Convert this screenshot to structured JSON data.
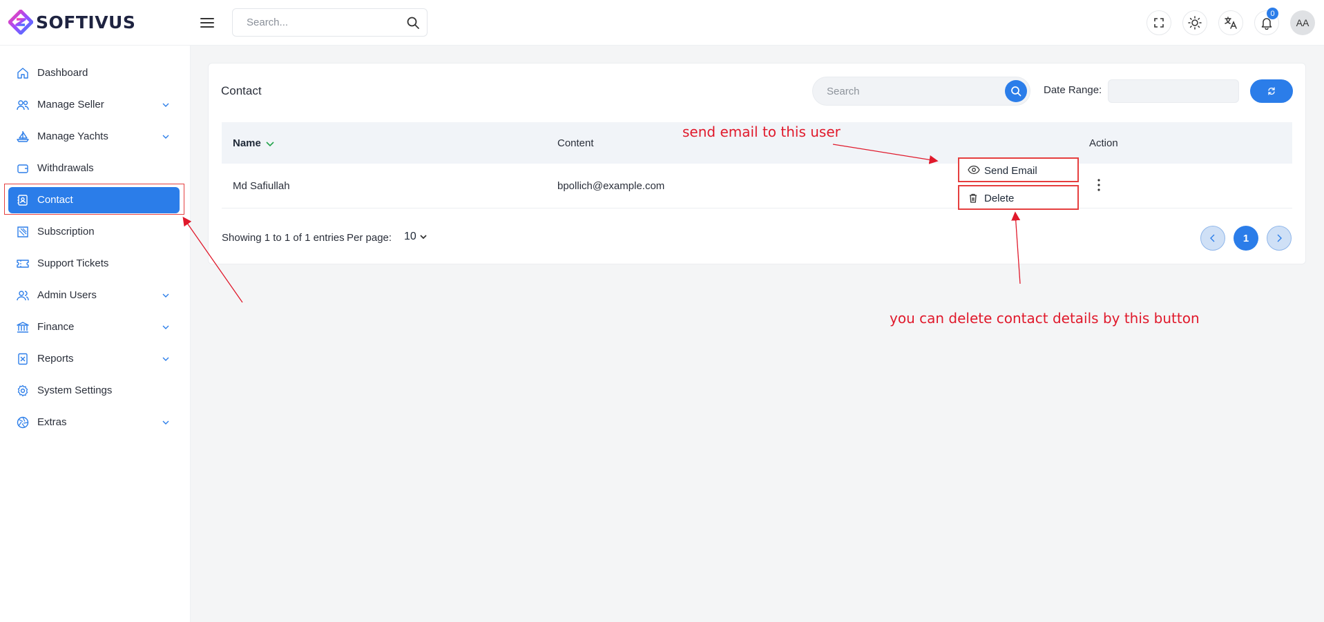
{
  "brand": {
    "name": "SOFTIVUS"
  },
  "header": {
    "search_placeholder": "Search...",
    "notifications_count": "0",
    "avatar_initials": "AA",
    "icons": [
      "menu-icon",
      "search-icon",
      "fullscreen-icon",
      "sun-icon",
      "translate-icon",
      "bell-icon"
    ]
  },
  "sidebar": {
    "items": [
      {
        "label": "Dashboard",
        "icon": "home-icon",
        "chevron": false
      },
      {
        "label": "Manage Seller",
        "icon": "users-icon",
        "chevron": true
      },
      {
        "label": "Manage Yachts",
        "icon": "sailboat-icon",
        "chevron": true
      },
      {
        "label": "Withdrawals",
        "icon": "wallet-icon",
        "chevron": false
      },
      {
        "label": "Contact",
        "icon": "contact-book-icon",
        "chevron": false,
        "active": true
      },
      {
        "label": "Subscription",
        "icon": "subscription-icon",
        "chevron": false
      },
      {
        "label": "Support Tickets",
        "icon": "ticket-icon",
        "chevron": false
      },
      {
        "label": "Admin Users",
        "icon": "admin-users-icon",
        "chevron": true
      },
      {
        "label": "Finance",
        "icon": "bank-icon",
        "chevron": true
      },
      {
        "label": "Reports",
        "icon": "report-icon",
        "chevron": true
      },
      {
        "label": "System Settings",
        "icon": "gear-icon",
        "chevron": false
      },
      {
        "label": "Extras",
        "icon": "aperture-icon",
        "chevron": true
      }
    ]
  },
  "page": {
    "title": "Contact",
    "search_placeholder": "Search",
    "date_range_label": "Date Range:",
    "date_range_value": ""
  },
  "table": {
    "columns": {
      "name": "Name",
      "content": "Content",
      "action": "Action"
    },
    "rows": [
      {
        "name": "Md Safiullah",
        "content": "bpollich@example.com"
      }
    ]
  },
  "action_menu": {
    "send_email": "Send Email",
    "delete": "Delete"
  },
  "footer": {
    "showing": "Showing 1 to 1 of 1 entries",
    "per_page_label": "Per page:",
    "per_page_value": "10",
    "current_page": "1"
  },
  "annotations": {
    "send_email_note": "send email to this user",
    "delete_note": "you can delete contact details by this button"
  },
  "colors": {
    "primary": "#2b7de9",
    "annotation": "#e0192b",
    "sort_arrow": "#22a34a"
  }
}
